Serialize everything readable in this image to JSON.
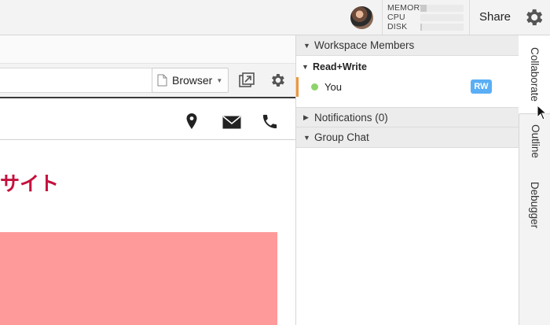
{
  "topbar": {
    "meters": [
      {
        "label": "MEMORY",
        "fill": 0.15
      },
      {
        "label": "CPU",
        "fill": 0.0
      },
      {
        "label": "DISK",
        "fill": 0.04
      }
    ],
    "share_label": "Share",
    "icons": {
      "settings": "gear-icon",
      "avatar": "user-avatar"
    }
  },
  "editor": {
    "browser_button_label": "Browser",
    "icons": [
      "doc-icon",
      "popout-icon",
      "gear-icon"
    ]
  },
  "preview": {
    "header_icons": [
      "map-pin-icon",
      "mail-icon",
      "phone-icon"
    ],
    "site_title": "サイト",
    "block_color": "#ff9a9a",
    "title_color": "#c4123d"
  },
  "collab_panel": {
    "workspace_members_label": "Workspace Members",
    "group_label": "Read+Write",
    "member_name": "You",
    "member_badge": "RW",
    "notifications_label": "Notifications (0)",
    "group_chat_label": "Group Chat"
  },
  "side_tabs": [
    "Collaborate",
    "Outline",
    "Debugger"
  ],
  "colors": {
    "accent_orange": "#f0963a",
    "badge_blue": "#5aaef5",
    "online_green": "#8fd36a"
  }
}
